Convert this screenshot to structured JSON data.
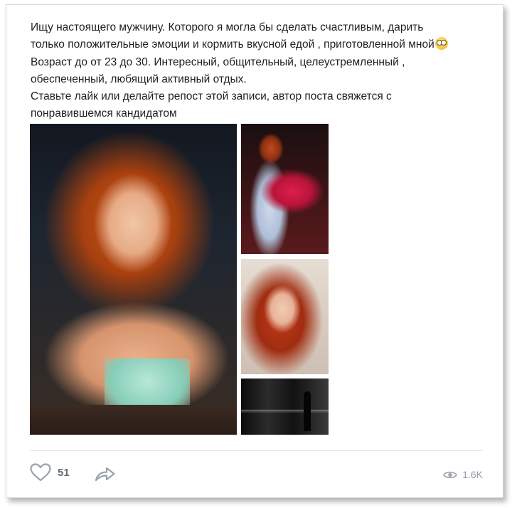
{
  "post": {
    "lines": [
      "Ищу настоящего мужчину. Которого я могла бы сделать счастливым, дарить",
      "только положительные эмоции и кормить вкусной едой , приготовленной мной",
      "Возраст до от 23 до 30. Интересный, общительный, целеустремленный ,",
      "обеспеченный, любящий активный отдых.",
      "Ставьте лайк или делайте репост этой записи, автор поста свяжется с",
      "понравившемся кандидатом"
    ],
    "emoji": "flushed-face-emoji"
  },
  "actions": {
    "like_icon": "heart-icon",
    "like_count": "51",
    "share_icon": "share-arrow-icon",
    "views_icon": "eye-icon",
    "views_count": "1.6K"
  },
  "colors": {
    "text": "#1f1f1f",
    "icon": "#99a2ad",
    "count": "#5f6b7a",
    "divider": "#e3e4e8"
  }
}
